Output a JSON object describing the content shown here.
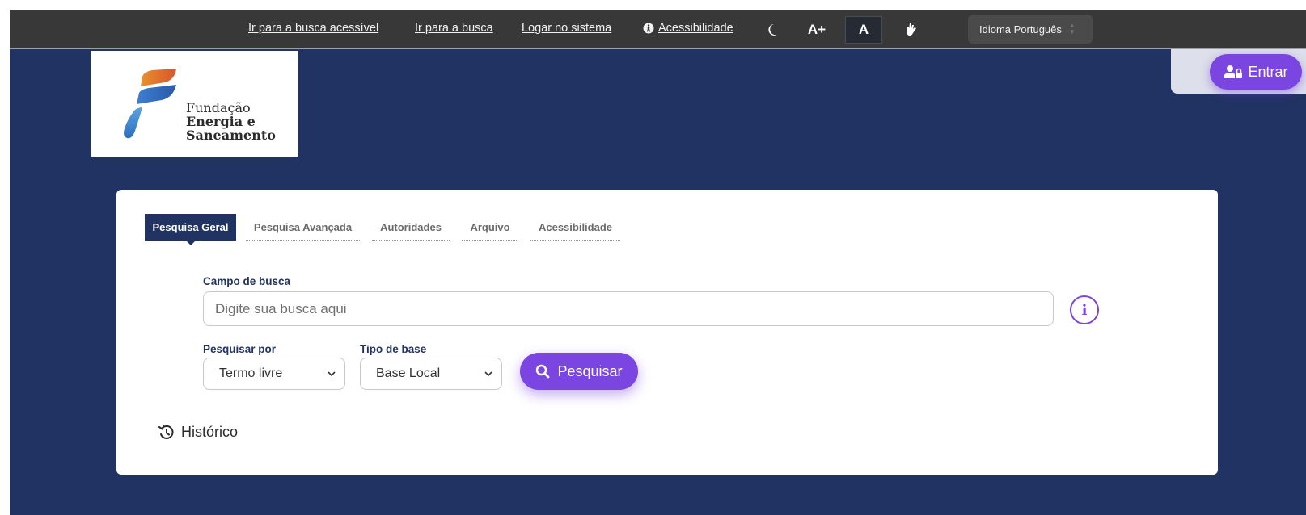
{
  "topbar": {
    "links": {
      "accessible_search": "Ir para a busca acessível",
      "goto_search": "Ir para a busca",
      "login": "Logar no sistema",
      "accessibility": "Acessibilidade"
    },
    "font_increase": "A+",
    "font_normal": "A",
    "language": "Idioma Português",
    "icons": [
      "accessibility-icon",
      "moon-icon",
      "sign-language-icon"
    ]
  },
  "logo": {
    "line1": "Fundação",
    "line2": "Energia e",
    "line3": "Saneamento"
  },
  "header": {
    "login_button": "Entrar"
  },
  "search": {
    "tabs": [
      "Pesquisa Geral",
      "Pesquisa Avançada",
      "Autoridades",
      "Arquivo",
      "Acessibilidade"
    ],
    "field_label": "Campo de busca",
    "placeholder": "Digite sua busca aqui",
    "search_by_label": "Pesquisar por",
    "search_by_value": "Termo livre",
    "base_type_label": "Tipo de base",
    "base_type_value": "Base Local",
    "submit": "Pesquisar",
    "history": "Histórico"
  },
  "colors": {
    "background": "#213363",
    "topbar": "#383838",
    "accent": "#7a45e0"
  }
}
